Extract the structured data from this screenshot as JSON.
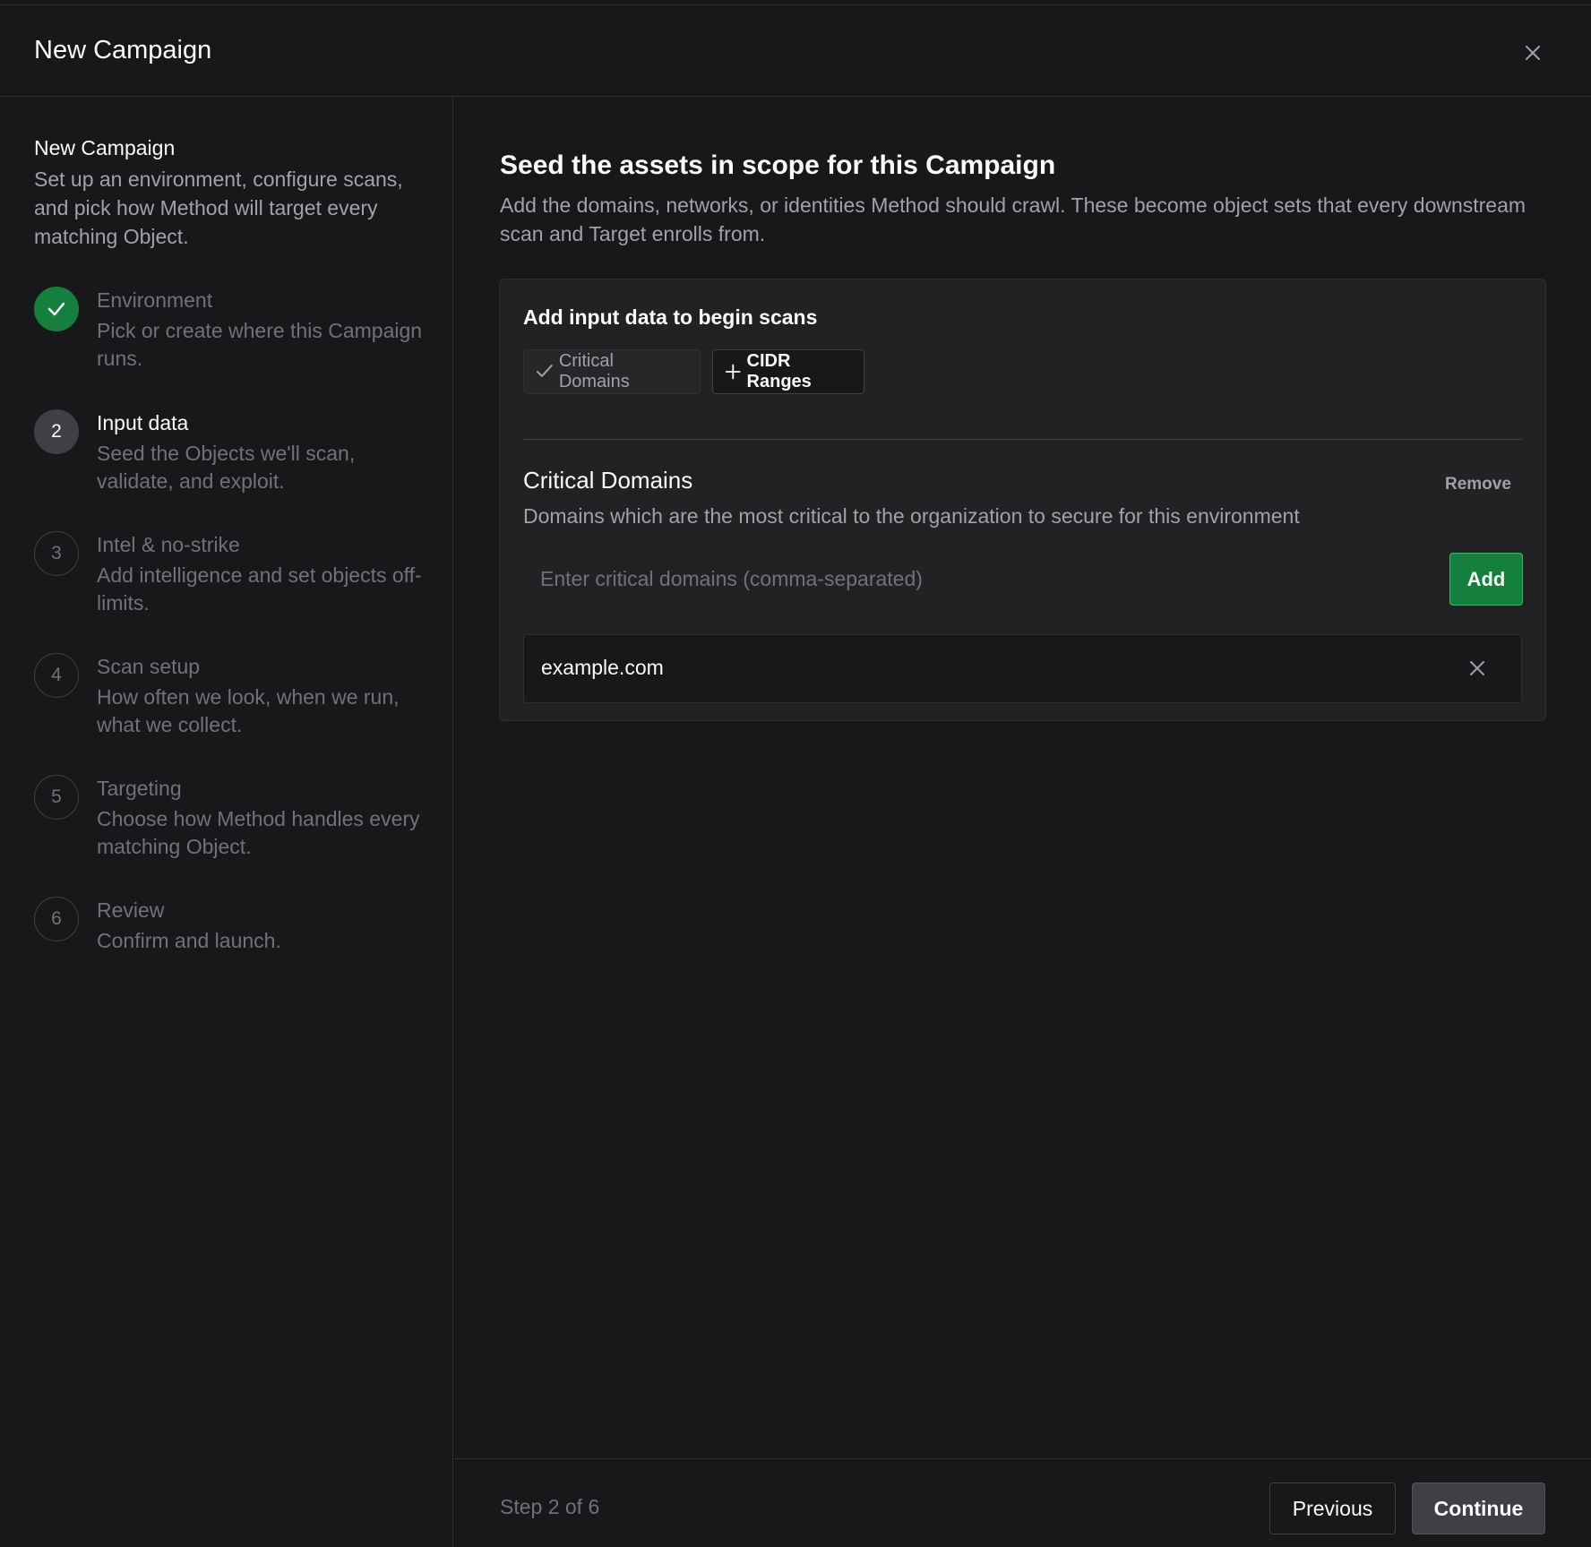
{
  "header": {
    "title": "New Campaign",
    "close_icon": "close-icon"
  },
  "sidebar": {
    "title": "New Campaign",
    "description": "Set up an environment, configure scans, and pick how Method will target every matching Object.",
    "steps": [
      {
        "number": "",
        "label": "Environment",
        "description": "Pick or create where this Campaign runs.",
        "state": "done"
      },
      {
        "number": "2",
        "label": "Input data",
        "description": "Seed the Objects we'll scan, validate, and exploit.",
        "state": "active"
      },
      {
        "number": "3",
        "label": "Intel & no-strike",
        "description": "Add intelligence and set objects off-limits.",
        "state": "pending"
      },
      {
        "number": "4",
        "label": "Scan setup",
        "description": "How often we look, when we run, what we collect.",
        "state": "pending"
      },
      {
        "number": "5",
        "label": "Targeting",
        "description": "Choose how Method handles every matching Object.",
        "state": "pending"
      },
      {
        "number": "6",
        "label": "Review",
        "description": "Confirm and launch.",
        "state": "pending"
      }
    ]
  },
  "main": {
    "title": "Seed the assets in scope for this Campaign",
    "description": "Add the domains, networks, or identities Method should crawl. These become object sets that every downstream scan and Target enrolls from.",
    "card": {
      "title": "Add input data to begin scans",
      "chips": [
        {
          "label": "Critical Domains",
          "icon": "check-icon",
          "selected": true
        },
        {
          "label": "CIDR Ranges",
          "icon": "plus-icon",
          "selected": false
        }
      ],
      "section": {
        "title": "Critical Domains",
        "remove_label": "Remove",
        "description": "Domains which are the most critical to the organization to secure for this environment",
        "input_value": "",
        "input_placeholder": "Enter critical domains (comma-separated)",
        "add_label": "Add",
        "domains": [
          "example.com"
        ]
      }
    }
  },
  "footer": {
    "step_text": "Step 2 of 6",
    "previous_label": "Previous",
    "continue_label": "Continue"
  },
  "colors": {
    "background": "#18181b",
    "card": "#222225",
    "border": "#2e2e33",
    "accent_green": "#15803d",
    "muted_text": "#a1a1aa",
    "dim_text": "#71717a"
  }
}
